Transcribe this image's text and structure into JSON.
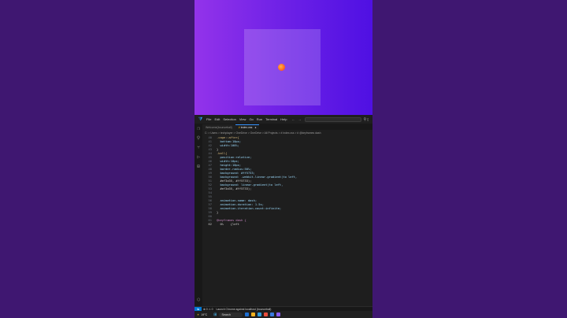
{
  "colors": {
    "preview_left": "#9333ea",
    "preview_right": "#4f10e3",
    "ball": "#ff5a1f",
    "editor_bg": "#1e1e1e"
  },
  "titlebar": {
    "logo_icon": "vscode-logo-icon",
    "menu": [
      "File",
      "Edit",
      "Selection",
      "View",
      "Go",
      "Run",
      "Terminal",
      "Help"
    ],
    "back": "←",
    "forward": "→",
    "search_icon": "search-icon"
  },
  "tabs": [
    {
      "label": "Welcome(bounceball)",
      "active": false
    },
    {
      "label": "index.css",
      "active": true,
      "close": "●"
    }
  ],
  "breadcrumb": "C: > Users > techplayer > OneDrive > OneDrive > All Projects > # index.css > # @keyframes dash",
  "editor": {
    "lines": [
      {
        "n": "40",
        "text": ".cage::after{"
      },
      {
        "n": "41",
        "text": "  bottom:10px;"
      },
      {
        "n": "42",
        "text": "  width:100%;"
      },
      {
        "n": "43",
        "text": "}"
      },
      {
        "n": "44",
        "text": ".ball{"
      },
      {
        "n": "45",
        "text": "  position:relative;"
      },
      {
        "n": "46",
        "text": "  width:10px;"
      },
      {
        "n": "47",
        "text": "  height:10px;"
      },
      {
        "n": "48",
        "text": "  border-radius:50%;"
      },
      {
        "n": "49",
        "text": "  background: #ff5733;"
      },
      {
        "n": "50",
        "text": "  background: -webkit-linear-gradient(to left,"
      },
      {
        "n": "51",
        "text": "  #ef3a35, #ff5733);"
      },
      {
        "n": "52",
        "text": "  background: linear-gradient(to left,"
      },
      {
        "n": "53",
        "text": "  #ef3a35, #ff5733);"
      },
      {
        "n": "54",
        "text": ""
      },
      {
        "n": "55",
        "text": ""
      },
      {
        "n": "56",
        "text": "  animation-name: dash;"
      },
      {
        "n": "57",
        "text": "  animation-duration: 1.5s;"
      },
      {
        "n": "58",
        "text": "  animation-iteration-count:infinite;"
      },
      {
        "n": "59",
        "text": "}"
      },
      {
        "n": "60",
        "text": ""
      },
      {
        "n": "61",
        "text": "@keyframes dash {"
      },
      {
        "n": "62",
        "text": "  0%    {left"
      }
    ],
    "current_line": "62"
  },
  "statusbar": {
    "remote": "⇆",
    "errors": "⊗ 0 ⚠ 0",
    "launch": "Launch Chrome against localhost (bounceball)"
  },
  "taskbar": {
    "temp": "19°C",
    "weather_icon": "sun-icon",
    "search": "Search",
    "windows_icon": "windows-icon"
  }
}
